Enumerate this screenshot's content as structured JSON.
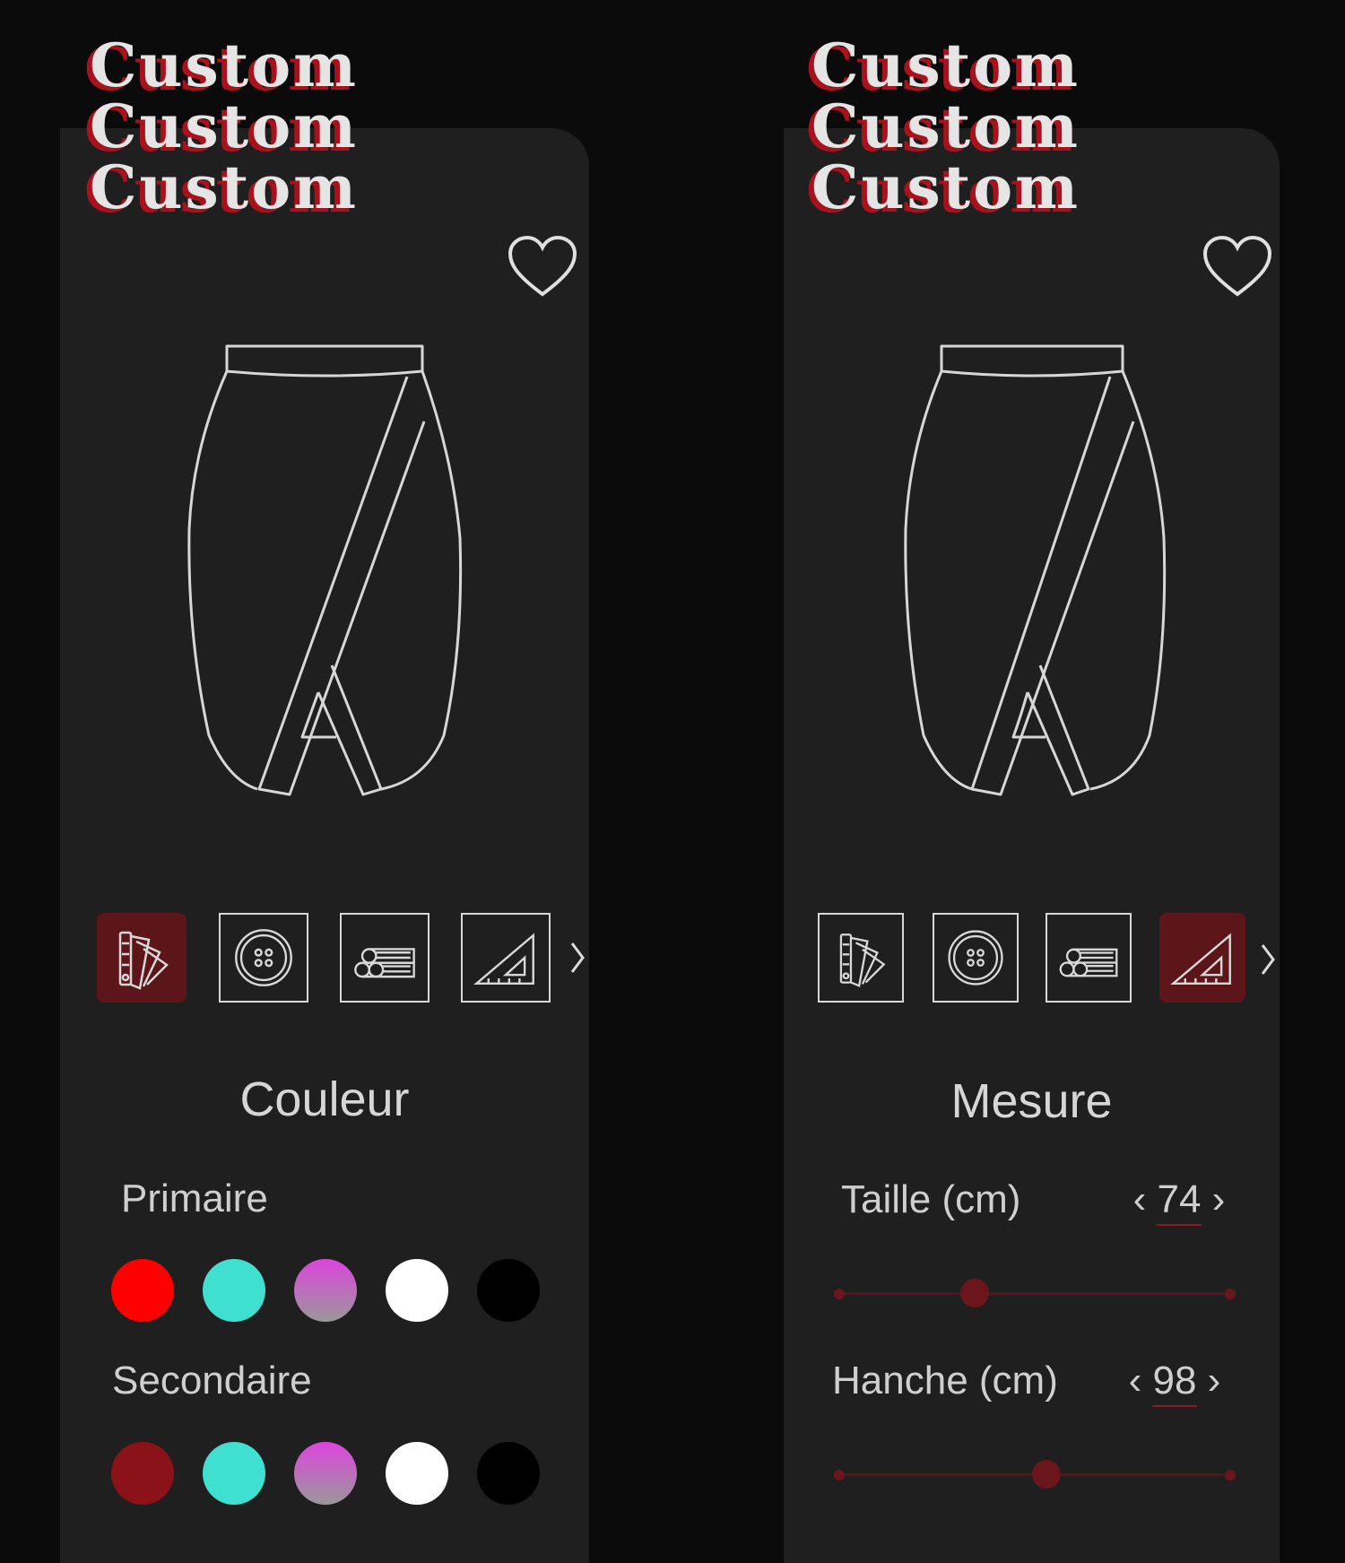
{
  "logo": {
    "text": "Custom"
  },
  "left": {
    "section_title": "Couleur",
    "primary_label": "Primaire",
    "secondary_label": "Secondaire",
    "primary_colors": [
      "#ff0000",
      "#40e0d0",
      "#cc55cc",
      "#ffffff",
      "#000000"
    ],
    "secondary_colors": [
      "#8a1218",
      "#40e0d0",
      "#cc55cc",
      "#ffffff",
      "#000000"
    ],
    "tools": [
      "palette-icon",
      "button-icon",
      "fabric-rolls-icon",
      "set-square-icon"
    ],
    "active_tool": 0
  },
  "right": {
    "section_title": "Mesure",
    "active_tool": 3,
    "measurements": [
      {
        "label": "Taille (cm)",
        "value": "74",
        "prev": "‹",
        "next": "›",
        "level": 0.35
      },
      {
        "label": "Hanche (cm)",
        "value": "98",
        "prev": "‹",
        "next": "›",
        "level": 0.53
      }
    ]
  }
}
